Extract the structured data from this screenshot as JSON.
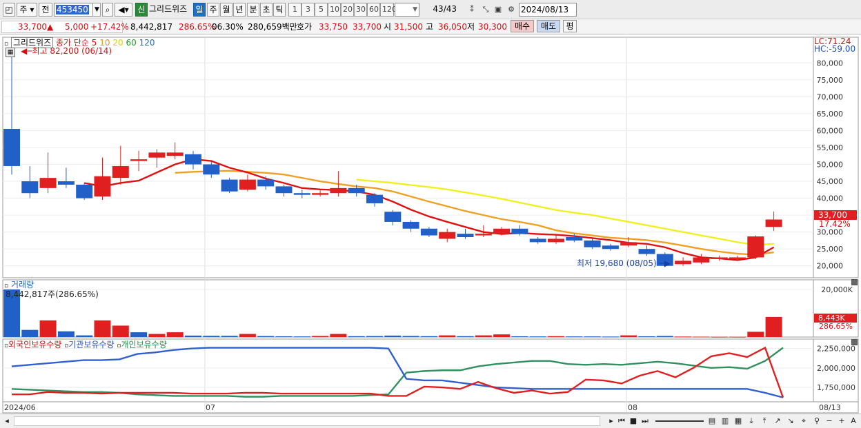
{
  "toolbar": {
    "period_label": "주",
    "prev_label": "전",
    "code": "453450",
    "new_badge": "신",
    "name": "그리드위즈",
    "tabs": [
      "일",
      "주",
      "월",
      "년",
      "분",
      "초",
      "틱"
    ],
    "active_tab": "일",
    "intervals": [
      "1",
      "3",
      "5",
      "10",
      "20",
      "30",
      "60",
      "120"
    ],
    "count": "43",
    "total": "/43",
    "date": "2024/08/13"
  },
  "quote": {
    "price": "33,700",
    "change": "5,000",
    "change_pct": "+17.42%",
    "volume": "8,442,817",
    "volume_ratio": "286.65%",
    "turnover": "06.30%",
    "amount": "280,659백만",
    "bid_label": "호가",
    "ask": "33,750",
    "bid": "33,700",
    "open_label": "시",
    "open": "31,500",
    "high_label": "고",
    "high": "36,050",
    "low_label": "저",
    "low": "30,300",
    "buy_label": "매수",
    "sell_label": "매도",
    "eval_label": "평"
  },
  "colors": {
    "up": "#e02020",
    "down": "#2060c8",
    "ma5": "#e01010",
    "ma10": "#f0a020",
    "ma20": "#f0f020",
    "ma60": "#30a030",
    "ma120": "#3070c0",
    "foreign": "#e02020",
    "institution": "#3060d0",
    "individual": "#309060"
  },
  "price_panel": {
    "legend_name": "그리드위즈",
    "legend_ma": "종가 단순",
    "ma_periods": [
      "5",
      "10",
      "20",
      "60",
      "120"
    ],
    "high_note": "최고 82,200 (06/14)",
    "low_note": "최저 19,680 (08/05)",
    "lc": "LC:71.24",
    "hc": "HC:-59.00",
    "current": "33,700",
    "current_pct": "17.42%",
    "y_ticks": [
      "80,000",
      "75,000",
      "70,000",
      "65,000",
      "60,000",
      "55,000",
      "50,000",
      "45,000",
      "40,000",
      "35,000",
      "30,000",
      "25,000",
      "20,000"
    ]
  },
  "volume_panel": {
    "title": "거래량",
    "value_note": "8,442,817주(286.65%)",
    "y_tick": "20,000K",
    "current": "8,443K",
    "current_pct": "286.65%"
  },
  "holding_panel": {
    "legends": [
      "외국인보유수량",
      "기관보유수량",
      "개인보유수량"
    ],
    "y_ticks": [
      "2,250,000",
      "2,000,000",
      "1,750,000"
    ]
  },
  "x_axis": {
    "labels": [
      "2024/06",
      "07",
      "08",
      "08/13"
    ]
  },
  "chart_data": {
    "type": "candlestick",
    "y_range": [
      17500,
      82500
    ],
    "candles": [
      {
        "o": 60500,
        "c": 49500,
        "h": 82200,
        "l": 47000
      },
      {
        "o": 45000,
        "c": 41500,
        "h": 49500,
        "l": 40000
      },
      {
        "o": 43000,
        "c": 46000,
        "h": 53500,
        "l": 41500
      },
      {
        "o": 45000,
        "c": 44000,
        "h": 49000,
        "l": 43000
      },
      {
        "o": 44000,
        "c": 40000,
        "h": 44500,
        "l": 39500
      },
      {
        "o": 40500,
        "c": 46500,
        "h": 52000,
        "l": 39500
      },
      {
        "o": 46000,
        "c": 49500,
        "h": 55500,
        "l": 44000
      },
      {
        "o": 51000,
        "c": 51500,
        "h": 54000,
        "l": 48000
      },
      {
        "o": 52000,
        "c": 53500,
        "h": 54500,
        "l": 49000
      },
      {
        "o": 52500,
        "c": 53500,
        "h": 56500,
        "l": 51500
      },
      {
        "o": 53000,
        "c": 50000,
        "h": 54000,
        "l": 48500
      },
      {
        "o": 50000,
        "c": 47000,
        "h": 51000,
        "l": 46000
      },
      {
        "o": 45500,
        "c": 42000,
        "h": 46000,
        "l": 41500
      },
      {
        "o": 42500,
        "c": 45500,
        "h": 47000,
        "l": 42000
      },
      {
        "o": 45500,
        "c": 43500,
        "h": 46500,
        "l": 42500
      },
      {
        "o": 43500,
        "c": 41500,
        "h": 44000,
        "l": 40500
      },
      {
        "o": 41500,
        "c": 41000,
        "h": 42500,
        "l": 40000
      },
      {
        "o": 41000,
        "c": 41500,
        "h": 42500,
        "l": 40500
      },
      {
        "o": 41500,
        "c": 43000,
        "h": 48000,
        "l": 40500
      },
      {
        "o": 43000,
        "c": 41500,
        "h": 44000,
        "l": 40500
      },
      {
        "o": 41000,
        "c": 38500,
        "h": 41500,
        "l": 37500
      },
      {
        "o": 36000,
        "c": 33000,
        "h": 36500,
        "l": 32000
      },
      {
        "o": 33000,
        "c": 31000,
        "h": 33500,
        "l": 30000
      },
      {
        "o": 31000,
        "c": 29000,
        "h": 31500,
        "l": 28500
      },
      {
        "o": 28000,
        "c": 30000,
        "h": 31000,
        "l": 27000
      },
      {
        "o": 29500,
        "c": 28500,
        "h": 31000,
        "l": 28000
      },
      {
        "o": 29000,
        "c": 29500,
        "h": 32000,
        "l": 28500
      },
      {
        "o": 29500,
        "c": 31000,
        "h": 31500,
        "l": 29000
      },
      {
        "o": 31000,
        "c": 29500,
        "h": 32000,
        "l": 29000
      },
      {
        "o": 28000,
        "c": 27000,
        "h": 28500,
        "l": 26500
      },
      {
        "o": 27000,
        "c": 28000,
        "h": 29000,
        "l": 26500
      },
      {
        "o": 28500,
        "c": 27500,
        "h": 29500,
        "l": 27000
      },
      {
        "o": 27500,
        "c": 25500,
        "h": 28000,
        "l": 25000
      },
      {
        "o": 26000,
        "c": 25000,
        "h": 26500,
        "l": 24500
      },
      {
        "o": 26000,
        "c": 27000,
        "h": 28500,
        "l": 25500
      },
      {
        "o": 25000,
        "c": 23500,
        "h": 26000,
        "l": 23000
      },
      {
        "o": 23500,
        "c": 20000,
        "h": 24000,
        "l": 19680
      },
      {
        "o": 20500,
        "c": 21500,
        "h": 22500,
        "l": 20000
      },
      {
        "o": 21000,
        "c": 22500,
        "h": 23500,
        "l": 20500
      },
      {
        "o": 22000,
        "c": 22500,
        "h": 23000,
        "l": 21500
      },
      {
        "o": 22000,
        "c": 22500,
        "h": 23000,
        "l": 21500
      },
      {
        "o": 22500,
        "c": 28700,
        "h": 29000,
        "l": 22000
      },
      {
        "o": 31500,
        "c": 33700,
        "h": 36050,
        "l": 30300
      }
    ],
    "ma5": [
      null,
      null,
      null,
      null,
      44500,
      43500,
      44500,
      45200,
      47600,
      50000,
      51500,
      51000,
      49000,
      47600,
      45800,
      44500,
      43000,
      42600,
      42400,
      42000,
      41000,
      39000,
      36600,
      34600,
      33000,
      31500,
      30000,
      29400,
      29700,
      29400,
      29200,
      28800,
      28200,
      27600,
      26800,
      26500,
      25500,
      23800,
      22500,
      22200,
      21700,
      22500,
      25500
    ],
    "ma10": [
      null,
      null,
      null,
      null,
      null,
      null,
      null,
      null,
      null,
      47500,
      47800,
      48000,
      48100,
      47800,
      47500,
      47000,
      46000,
      45000,
      44200,
      43500,
      43000,
      42000,
      40500,
      39000,
      37600,
      36200,
      35000,
      33800,
      33000,
      32000,
      30500,
      29600,
      29000,
      28300,
      28000,
      27600,
      26900,
      26000,
      25000,
      24200,
      23600,
      23300,
      24000
    ],
    "ma20": [
      null,
      null,
      null,
      null,
      null,
      null,
      null,
      null,
      null,
      null,
      null,
      null,
      null,
      null,
      null,
      null,
      null,
      null,
      null,
      45500,
      45000,
      44500,
      43900,
      43300,
      42600,
      41700,
      40800,
      39800,
      38700,
      37600,
      36500,
      35700,
      35000,
      34000,
      33000,
      32000,
      31000,
      30000,
      29000,
      28000,
      27000,
      26200,
      26500
    ],
    "volume": [
      {
        "v": 20000,
        "up": false
      },
      {
        "v": 3000,
        "up": false
      },
      {
        "v": 7000,
        "up": true
      },
      {
        "v": 2400,
        "up": false
      },
      {
        "v": 700,
        "up": false
      },
      {
        "v": 7000,
        "up": true
      },
      {
        "v": 4800,
        "up": true
      },
      {
        "v": 2000,
        "up": false
      },
      {
        "v": 1300,
        "up": true
      },
      {
        "v": 2000,
        "up": true
      },
      {
        "v": 600,
        "up": false
      },
      {
        "v": 500,
        "up": false
      },
      {
        "v": 500,
        "up": false
      },
      {
        "v": 1300,
        "up": true
      },
      {
        "v": 400,
        "up": false
      },
      {
        "v": 300,
        "up": false
      },
      {
        "v": 250,
        "up": false
      },
      {
        "v": 450,
        "up": true
      },
      {
        "v": 1300,
        "up": true
      },
      {
        "v": 350,
        "up": false
      },
      {
        "v": 400,
        "up": false
      },
      {
        "v": 600,
        "up": false
      },
      {
        "v": 450,
        "up": false
      },
      {
        "v": 350,
        "up": false
      },
      {
        "v": 700,
        "up": true
      },
      {
        "v": 350,
        "up": false
      },
      {
        "v": 700,
        "up": true
      },
      {
        "v": 1100,
        "up": true
      },
      {
        "v": 300,
        "up": false
      },
      {
        "v": 250,
        "up": false
      },
      {
        "v": 350,
        "up": true
      },
      {
        "v": 250,
        "up": false
      },
      {
        "v": 250,
        "up": false
      },
      {
        "v": 200,
        "up": false
      },
      {
        "v": 700,
        "up": true
      },
      {
        "v": 300,
        "up": false
      },
      {
        "v": 450,
        "up": false
      },
      {
        "v": 200,
        "up": true
      },
      {
        "v": 150,
        "up": true
      },
      {
        "v": 100,
        "up": true
      },
      {
        "v": 100,
        "up": true
      },
      {
        "v": 2200,
        "up": true
      },
      {
        "v": 8443,
        "up": true
      }
    ],
    "holding_y_range": [
      1600000,
      2300000
    ],
    "foreign": [
      1660000,
      1660000,
      1690000,
      1680000,
      1680000,
      1670000,
      1680000,
      1680000,
      1680000,
      1680000,
      1670000,
      1670000,
      1670000,
      1680000,
      1680000,
      1670000,
      1670000,
      1670000,
      1670000,
      1670000,
      1670000,
      1640000,
      1640000,
      1760000,
      1750000,
      1730000,
      1820000,
      1740000,
      1680000,
      1710000,
      1670000,
      1690000,
      1850000,
      1840000,
      1800000,
      1900000,
      1960000,
      1880000,
      2000000,
      2150000,
      2190000,
      2140000,
      2260000,
      1620000
    ],
    "institution": [
      2020000,
      2040000,
      2060000,
      2080000,
      2100000,
      2100000,
      2110000,
      2180000,
      2200000,
      2230000,
      2250000,
      2260000,
      2260000,
      2260000,
      2260000,
      2260000,
      2260000,
      2260000,
      2260000,
      2260000,
      2260000,
      2250000,
      1860000,
      1840000,
      1840000,
      1810000,
      1780000,
      1750000,
      1740000,
      1730000,
      1730000,
      1730000,
      1730000,
      1730000,
      1730000,
      1730000,
      1730000,
      1730000,
      1730000,
      1730000,
      1730000,
      1730000,
      1680000,
      1620000
    ],
    "individual": [
      1730000,
      1720000,
      1710000,
      1700000,
      1690000,
      1690000,
      1680000,
      1660000,
      1650000,
      1640000,
      1640000,
      1640000,
      1640000,
      1630000,
      1630000,
      1640000,
      1640000,
      1640000,
      1640000,
      1640000,
      1650000,
      1660000,
      1940000,
      1960000,
      1970000,
      1970000,
      2020000,
      2050000,
      2070000,
      2090000,
      2090000,
      2050000,
      2040000,
      2050000,
      2040000,
      2060000,
      2080000,
      2060000,
      2030000,
      2000000,
      2010000,
      1990000,
      2090000,
      2260000
    ]
  }
}
